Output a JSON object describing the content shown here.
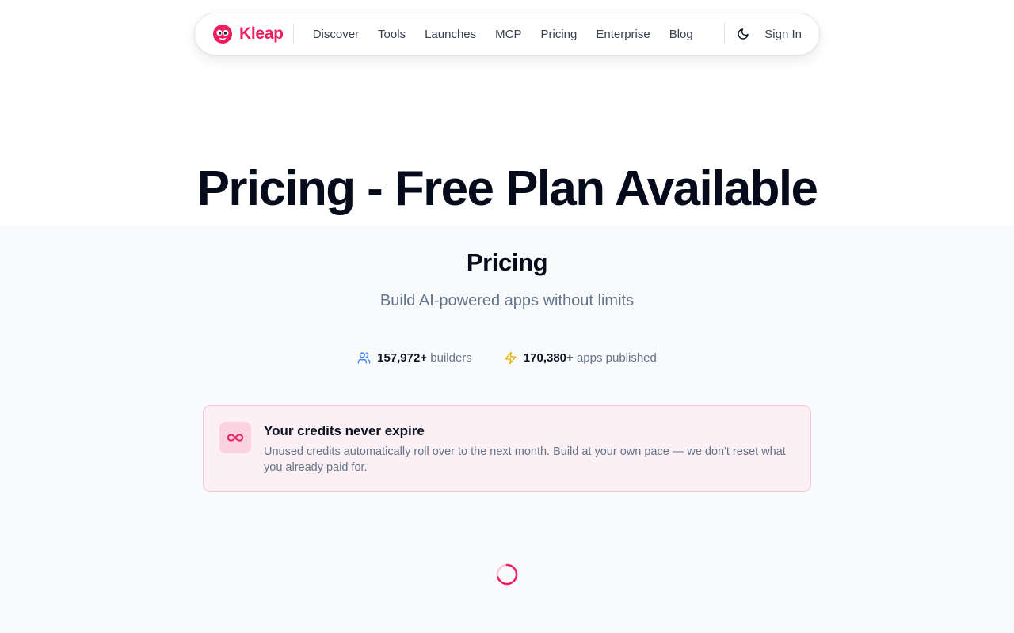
{
  "nav": {
    "brand": "Kleap",
    "links": [
      "Discover",
      "Tools",
      "Launches",
      "MCP",
      "Pricing",
      "Enterprise",
      "Blog"
    ],
    "theme_icon": "moon-icon",
    "sign_in": "Sign In"
  },
  "hero": {
    "title": "Pricing - Free Plan Available"
  },
  "pricing": {
    "heading": "Pricing",
    "subtitle": "Build AI-powered apps without limits"
  },
  "stats": [
    {
      "icon": "users-icon",
      "value": "157,972+",
      "label": "builders",
      "color": "#3b82f6"
    },
    {
      "icon": "lightning-icon",
      "value": "170,380+",
      "label": "apps published",
      "color": "#eab308"
    }
  ],
  "credits_card": {
    "icon": "infinity-icon",
    "title": "Your credits never expire",
    "body": "Unused credits automatically roll over to the next month. Build at your own pace — we don't reset what you already paid for."
  },
  "colors": {
    "brand": "#ec1e5f",
    "card_bg": "#fcf0f4",
    "card_border": "#f6c5d4"
  },
  "loading": {
    "icon": "spinner-icon"
  }
}
